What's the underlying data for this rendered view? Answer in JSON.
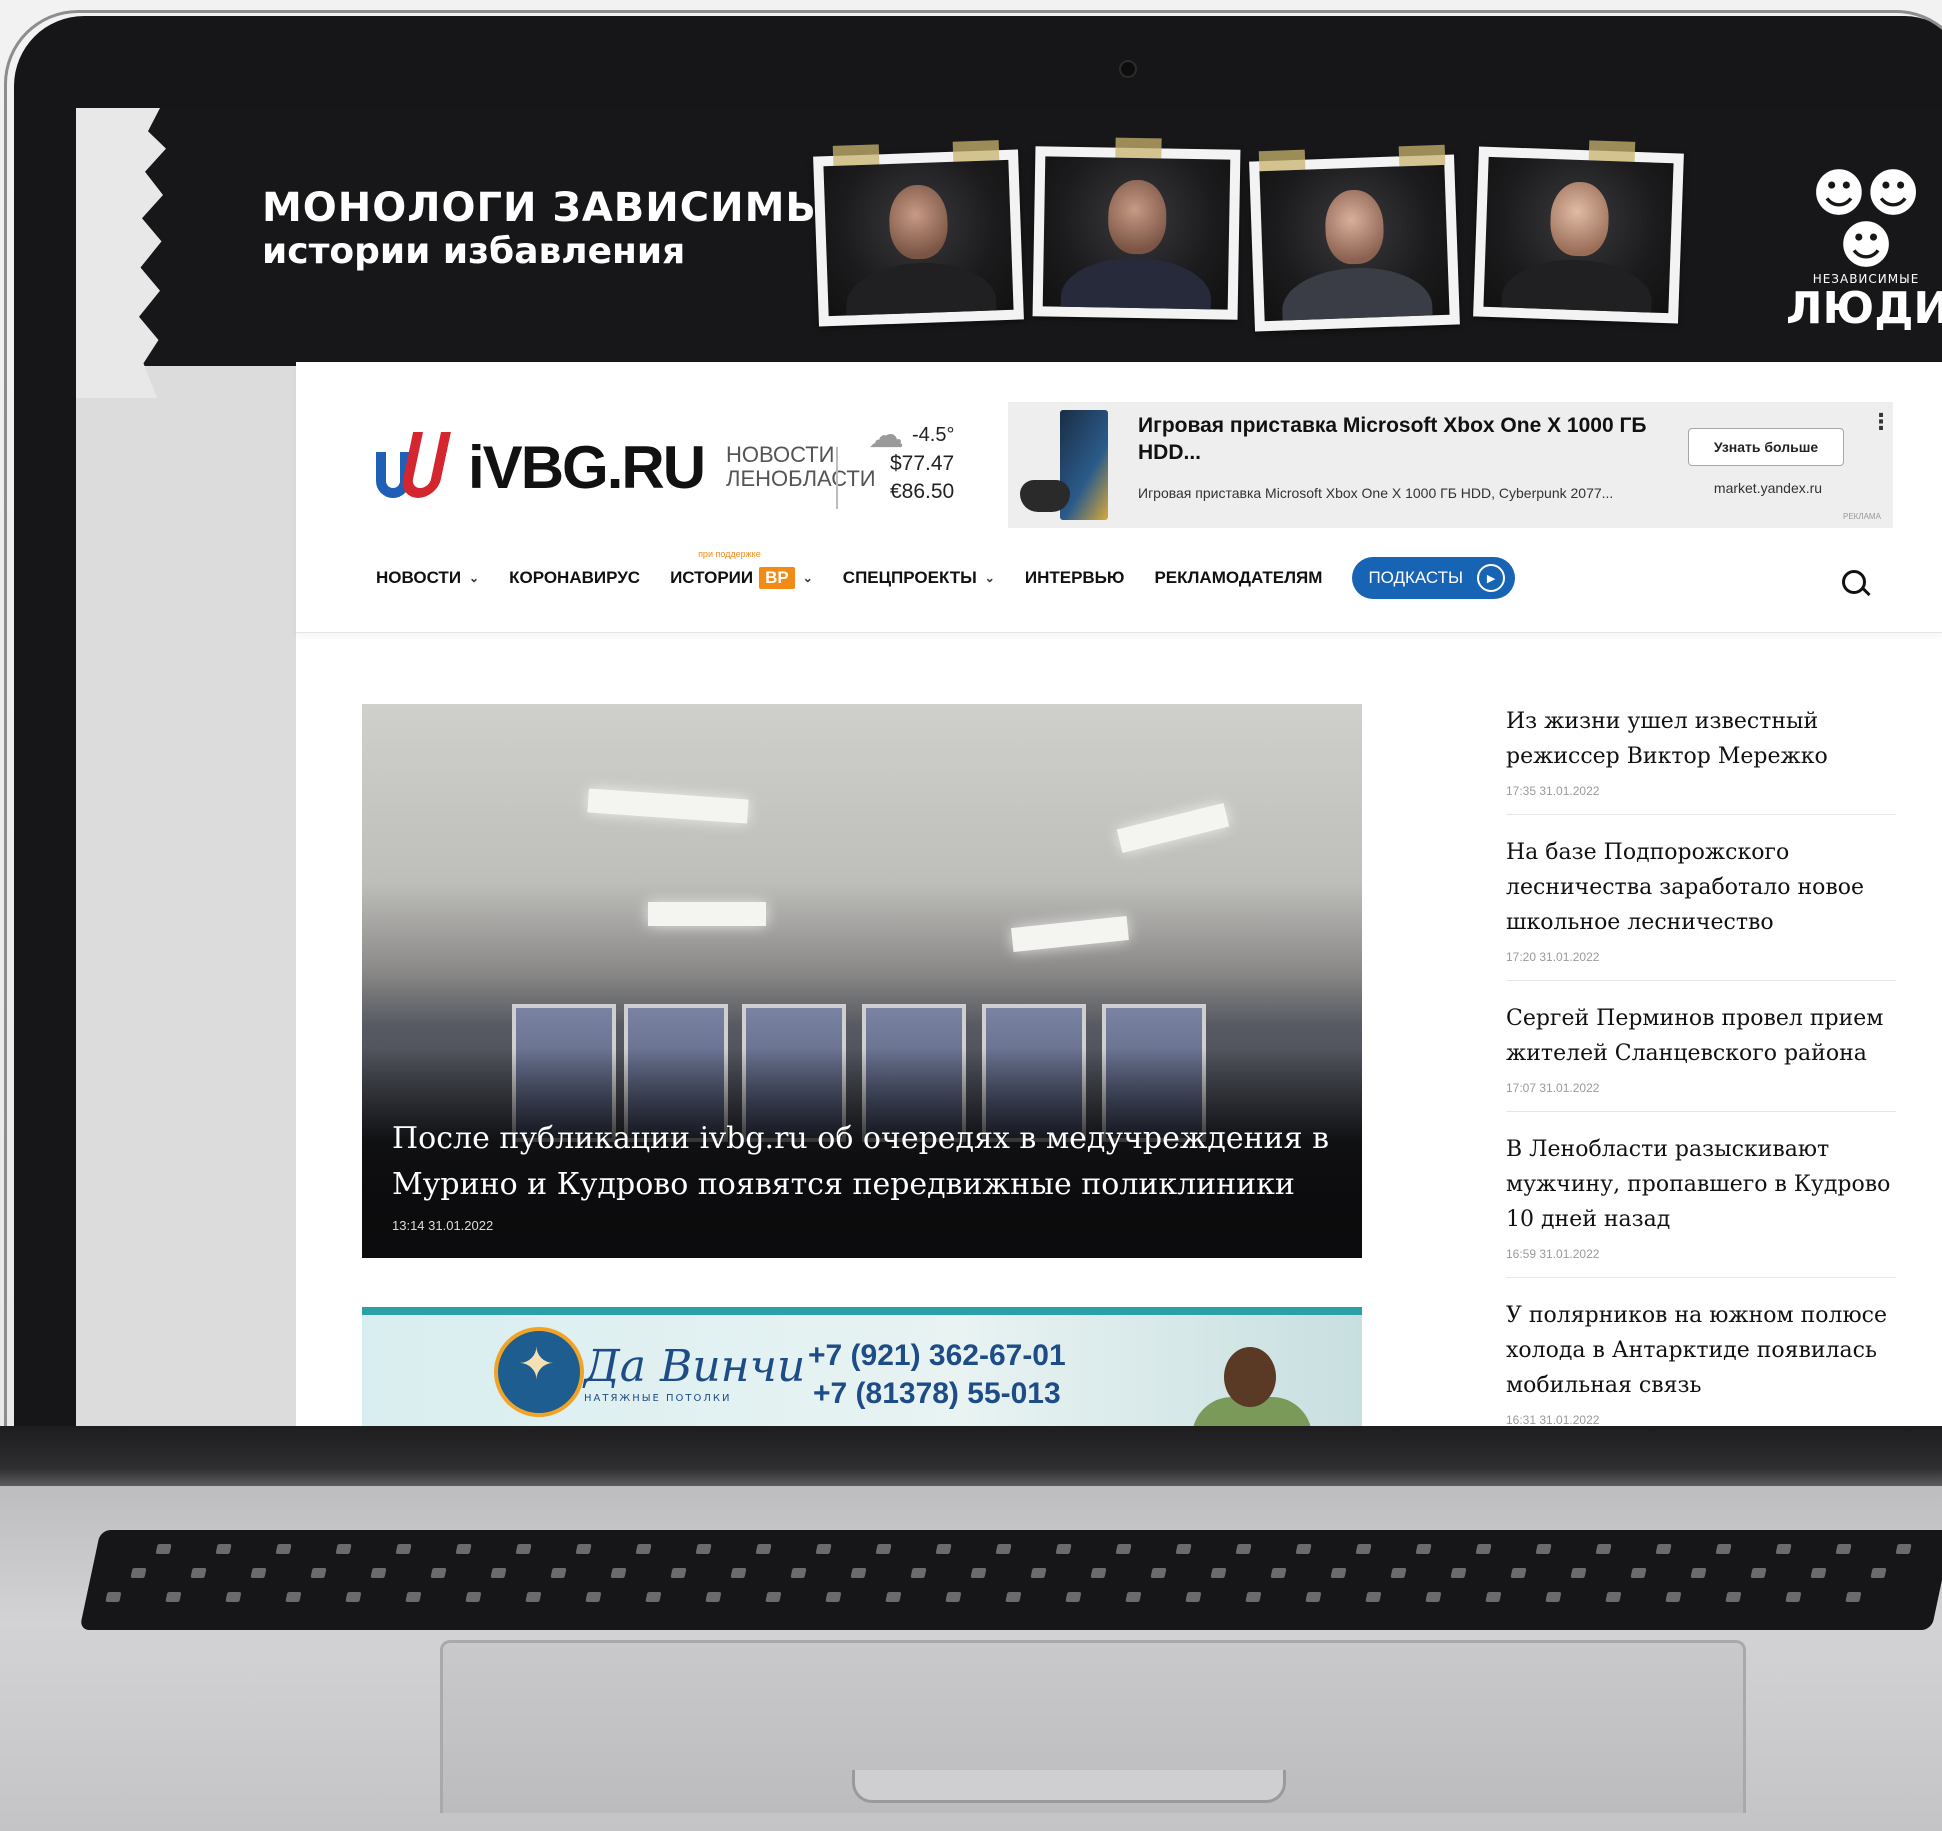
{
  "banner": {
    "title": "МОНОЛОГИ ЗАВИСИМЫХ",
    "subtitle": "истории избавления",
    "brand_small": "НЕЗАВИСИМЫЕ",
    "brand_big": "ЛЮДИ"
  },
  "site": {
    "logo_text": "iVBG.RU",
    "tagline_line1": "НОВОСТИ",
    "tagline_line2": "ЛЕНОБЛАСТИ"
  },
  "weather": {
    "temperature": "-4.5°",
    "usd": "$77.47",
    "eur": "€86.50"
  },
  "ad": {
    "title": "Игровая приставка Microsoft Xbox One X 1000 ГБ HDD...",
    "description": "Игровая приставка Microsoft Xbox One X 1000 ГБ HDD, Cyberpunk 2077...",
    "button": "Узнать больше",
    "domain": "market.yandex.ru",
    "label": "РЕКЛАМА",
    "menu": "⋮"
  },
  "nav": {
    "items": [
      {
        "label": "НОВОСТИ"
      },
      {
        "label": "КОРОНАВИРУС"
      },
      {
        "label": "ИСТОРИИ",
        "badge": "ВР",
        "note": "при поддержке"
      },
      {
        "label": "СПЕЦПРОЕКТЫ"
      },
      {
        "label": "ИНТЕРВЬЮ"
      },
      {
        "label": "РЕКЛАМОДАТЕЛЯМ"
      }
    ],
    "podcasts": "ПОДКАСТЫ"
  },
  "hero": {
    "title": "После публикации ivbg.ru об очередях в медучреждения в Мурино и Кудрово появятся передвижные поликлиники",
    "date": "13:14 31.01.2022"
  },
  "promo": {
    "name": "Да Винчи",
    "sub": "НАТЯЖНЫЕ ПОТОЛКИ",
    "phone1": "+7 (921) 362-67-01",
    "phone2": "+7 (81378) 55-013"
  },
  "sidebar": {
    "items": [
      {
        "title": "Из жизни ушел известный режиссер Виктор Мережко",
        "date": "17:35 31.01.2022"
      },
      {
        "title": "На базе Подпорожского лесничества заработало новое школьное лесничество",
        "date": "17:20 31.01.2022"
      },
      {
        "title": "Сергей Перминов провел прием жителей Сланцевского района",
        "date": "17:07 31.01.2022"
      },
      {
        "title": "В Ленобласти разыскивают мужчину, пропавшего в Кудрово 10 дней назад",
        "date": "16:59 31.01.2022"
      },
      {
        "title": "У полярников на южном полюсе холода в Антарктиде появилась мобильная связь",
        "date": "16:31 31.01.2022"
      }
    ]
  },
  "colors": {
    "brand_blue": "#1f5fb6",
    "brand_red": "#d4262f",
    "podcast_blue": "#1763b4",
    "vr_orange": "#f28a16"
  },
  "icons": [
    "search-icon",
    "cloud-icon",
    "play-icon",
    "chevron-down-icon",
    "more-vert-icon",
    "camera-icon"
  ]
}
